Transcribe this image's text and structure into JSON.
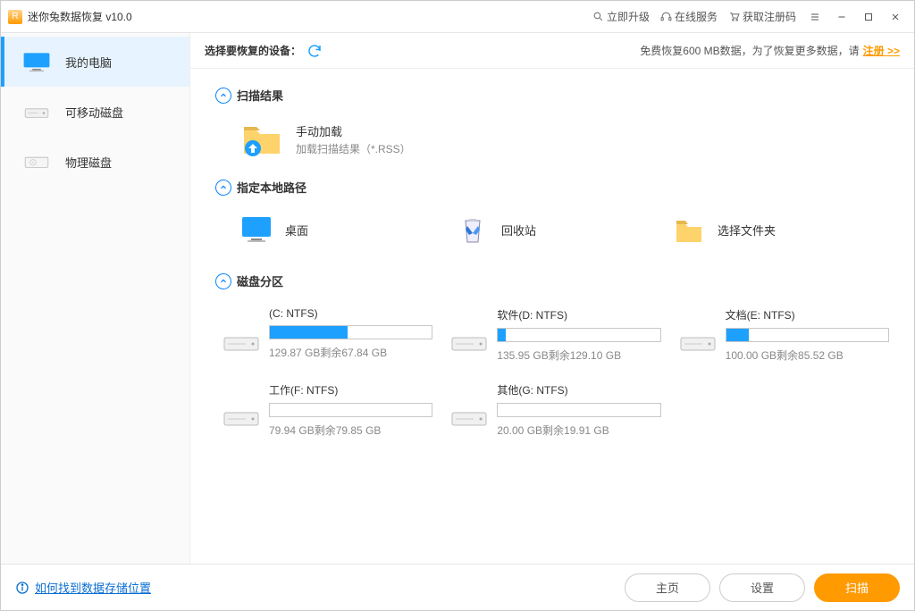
{
  "title": "迷你兔数据恢复 v10.0",
  "top_links": {
    "upgrade": "立即升级",
    "online_service": "在线服务",
    "get_code": "获取注册码"
  },
  "sidebar": {
    "my_pc": "我的电脑",
    "removable": "可移动磁盘",
    "physical": "物理磁盘"
  },
  "main_header": {
    "select_device": "选择要恢复的设备：",
    "free_text": "免费恢复600 MB数据，为了恢复更多数据，请",
    "register": "注册 >>"
  },
  "sections": {
    "scan_result": "扫描结果",
    "manual_load": {
      "title": "手动加载",
      "sub": "加载扫描结果（*.RSS）"
    },
    "local_path": "指定本地路径",
    "paths": {
      "desktop": "桌面",
      "recycle": "回收站",
      "choose_folder": "选择文件夹"
    },
    "partitions_title": "磁盘分区"
  },
  "partitions": [
    {
      "name": "(C: NTFS)",
      "size": "129.87 GB剩余67.84 GB",
      "used_pct": 48
    },
    {
      "name": "软件(D: NTFS)",
      "size": "135.95 GB剩余129.10 GB",
      "used_pct": 5
    },
    {
      "name": "文档(E: NTFS)",
      "size": "100.00 GB剩余85.52 GB",
      "used_pct": 14
    },
    {
      "name": "工作(F: NTFS)",
      "size": "79.94 GB剩余79.85 GB",
      "used_pct": 0
    },
    {
      "name": "其他(G: NTFS)",
      "size": "20.00 GB剩余19.91 GB",
      "used_pct": 0
    }
  ],
  "footer": {
    "help": "如何找到数据存储位置",
    "home": "主页",
    "settings": "设置",
    "scan": "扫描"
  }
}
